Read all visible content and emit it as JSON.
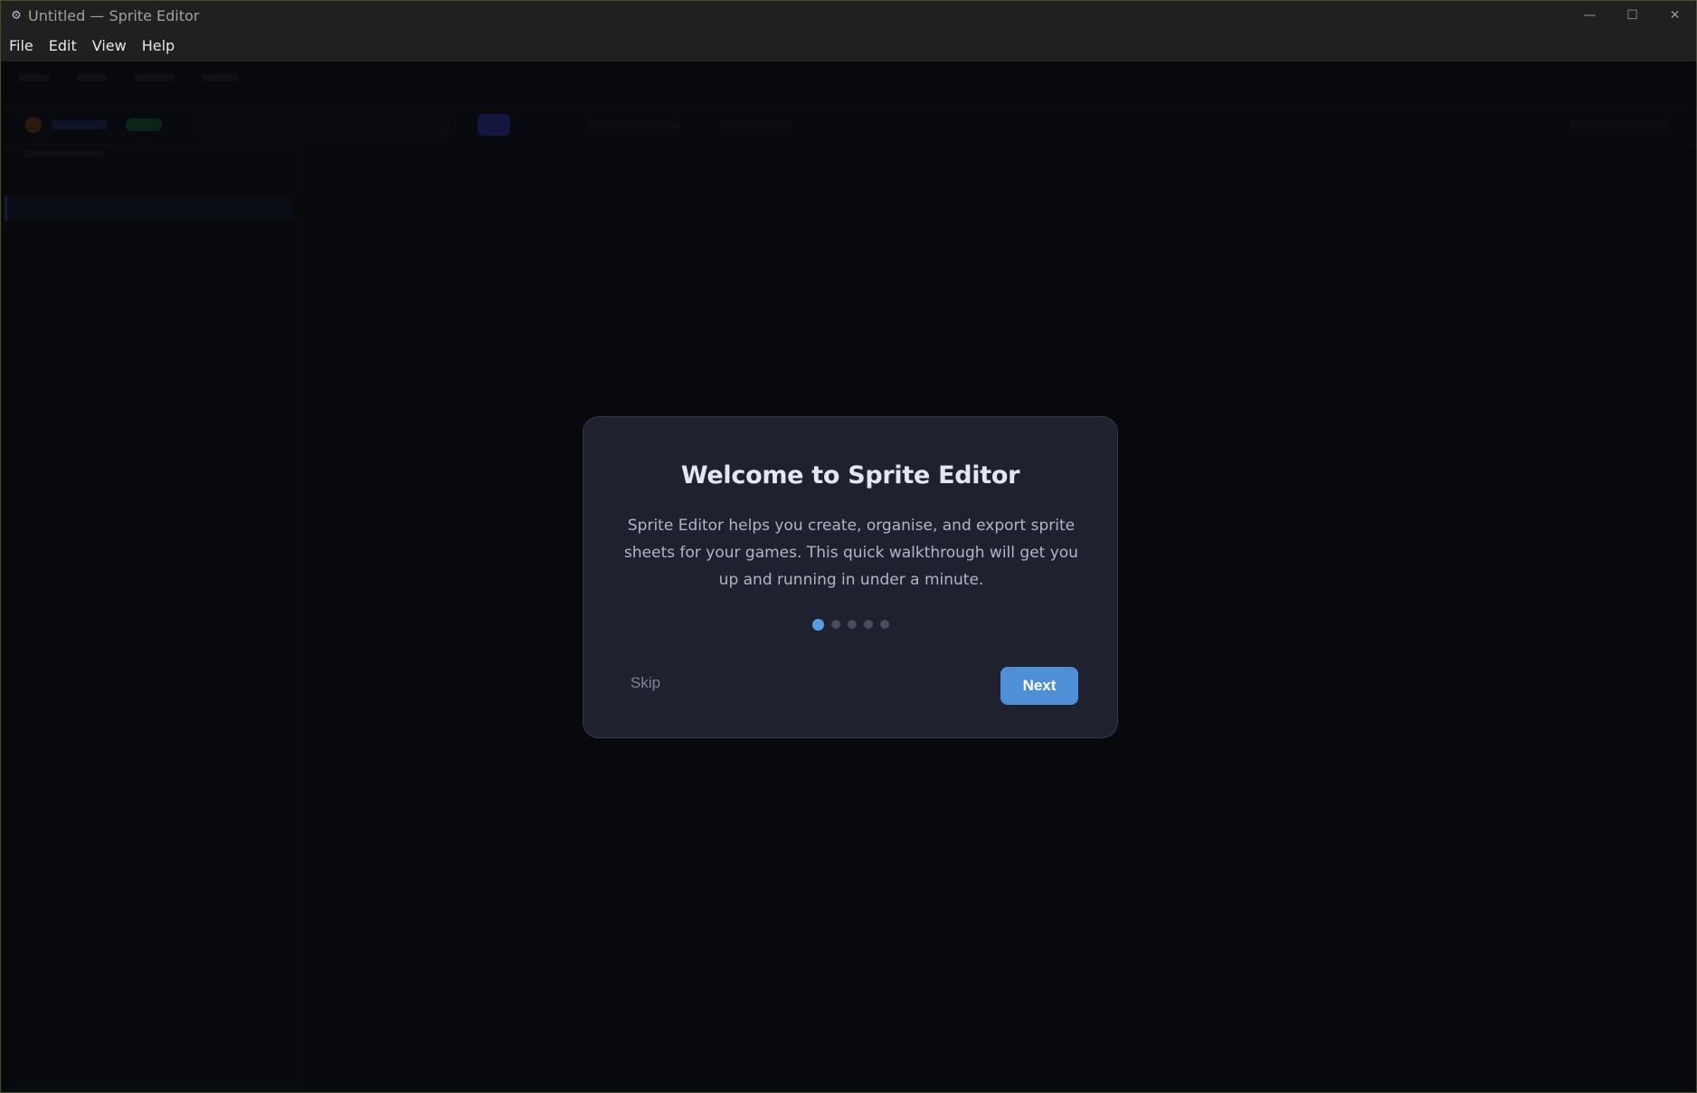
{
  "window": {
    "title": "Untitled — Sprite Editor",
    "app_icon": "gear-icon",
    "controls": {
      "minimize": "—",
      "maximize": "☐",
      "close": "✕"
    }
  },
  "menubar": {
    "items": [
      "File",
      "Edit",
      "View",
      "Help"
    ]
  },
  "modal": {
    "title": "Welcome to Sprite Editor",
    "body": "Sprite Editor helps you create, organise, and export sprite sheets for your games. This quick walkthrough will get you up and running in under a minute.",
    "step_count": 5,
    "active_step": 1,
    "skip_label": "Skip",
    "next_label": "Next",
    "accent_color": "#4f8fd6"
  }
}
